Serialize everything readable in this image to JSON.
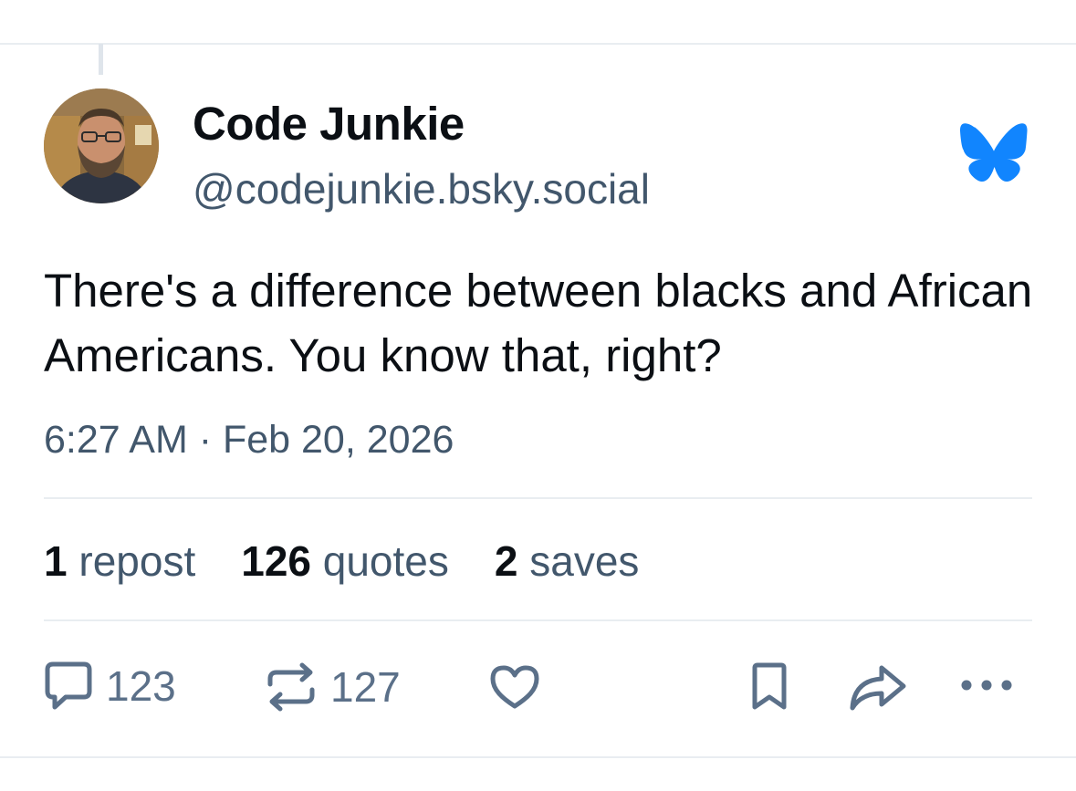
{
  "post": {
    "author": {
      "display_name": "Code Junkie",
      "handle": "@codejunkie.bsky.social"
    },
    "text": "There's a difference between blacks and African Americans. You know that, right?",
    "timestamp": "6:27 AM · Feb 20, 2026",
    "stats": {
      "reposts_count": "1",
      "reposts_label": "repost",
      "quotes_count": "126",
      "quotes_label": "quotes",
      "saves_count": "2",
      "saves_label": "saves"
    },
    "actions": {
      "reply_count": "123",
      "repost_count": "127"
    }
  },
  "icons": {
    "brand": "bluesky-butterfly-icon",
    "reply": "speech-bubble-icon",
    "repost": "repost-arrows-icon",
    "like": "heart-icon",
    "bookmark": "bookmark-icon",
    "share": "share-arrow-icon",
    "more": "ellipsis-icon"
  },
  "colors": {
    "brand": "#1185fe",
    "secondary_text": "#42576c",
    "icon": "#5b7089",
    "divider": "#e9edf1"
  }
}
